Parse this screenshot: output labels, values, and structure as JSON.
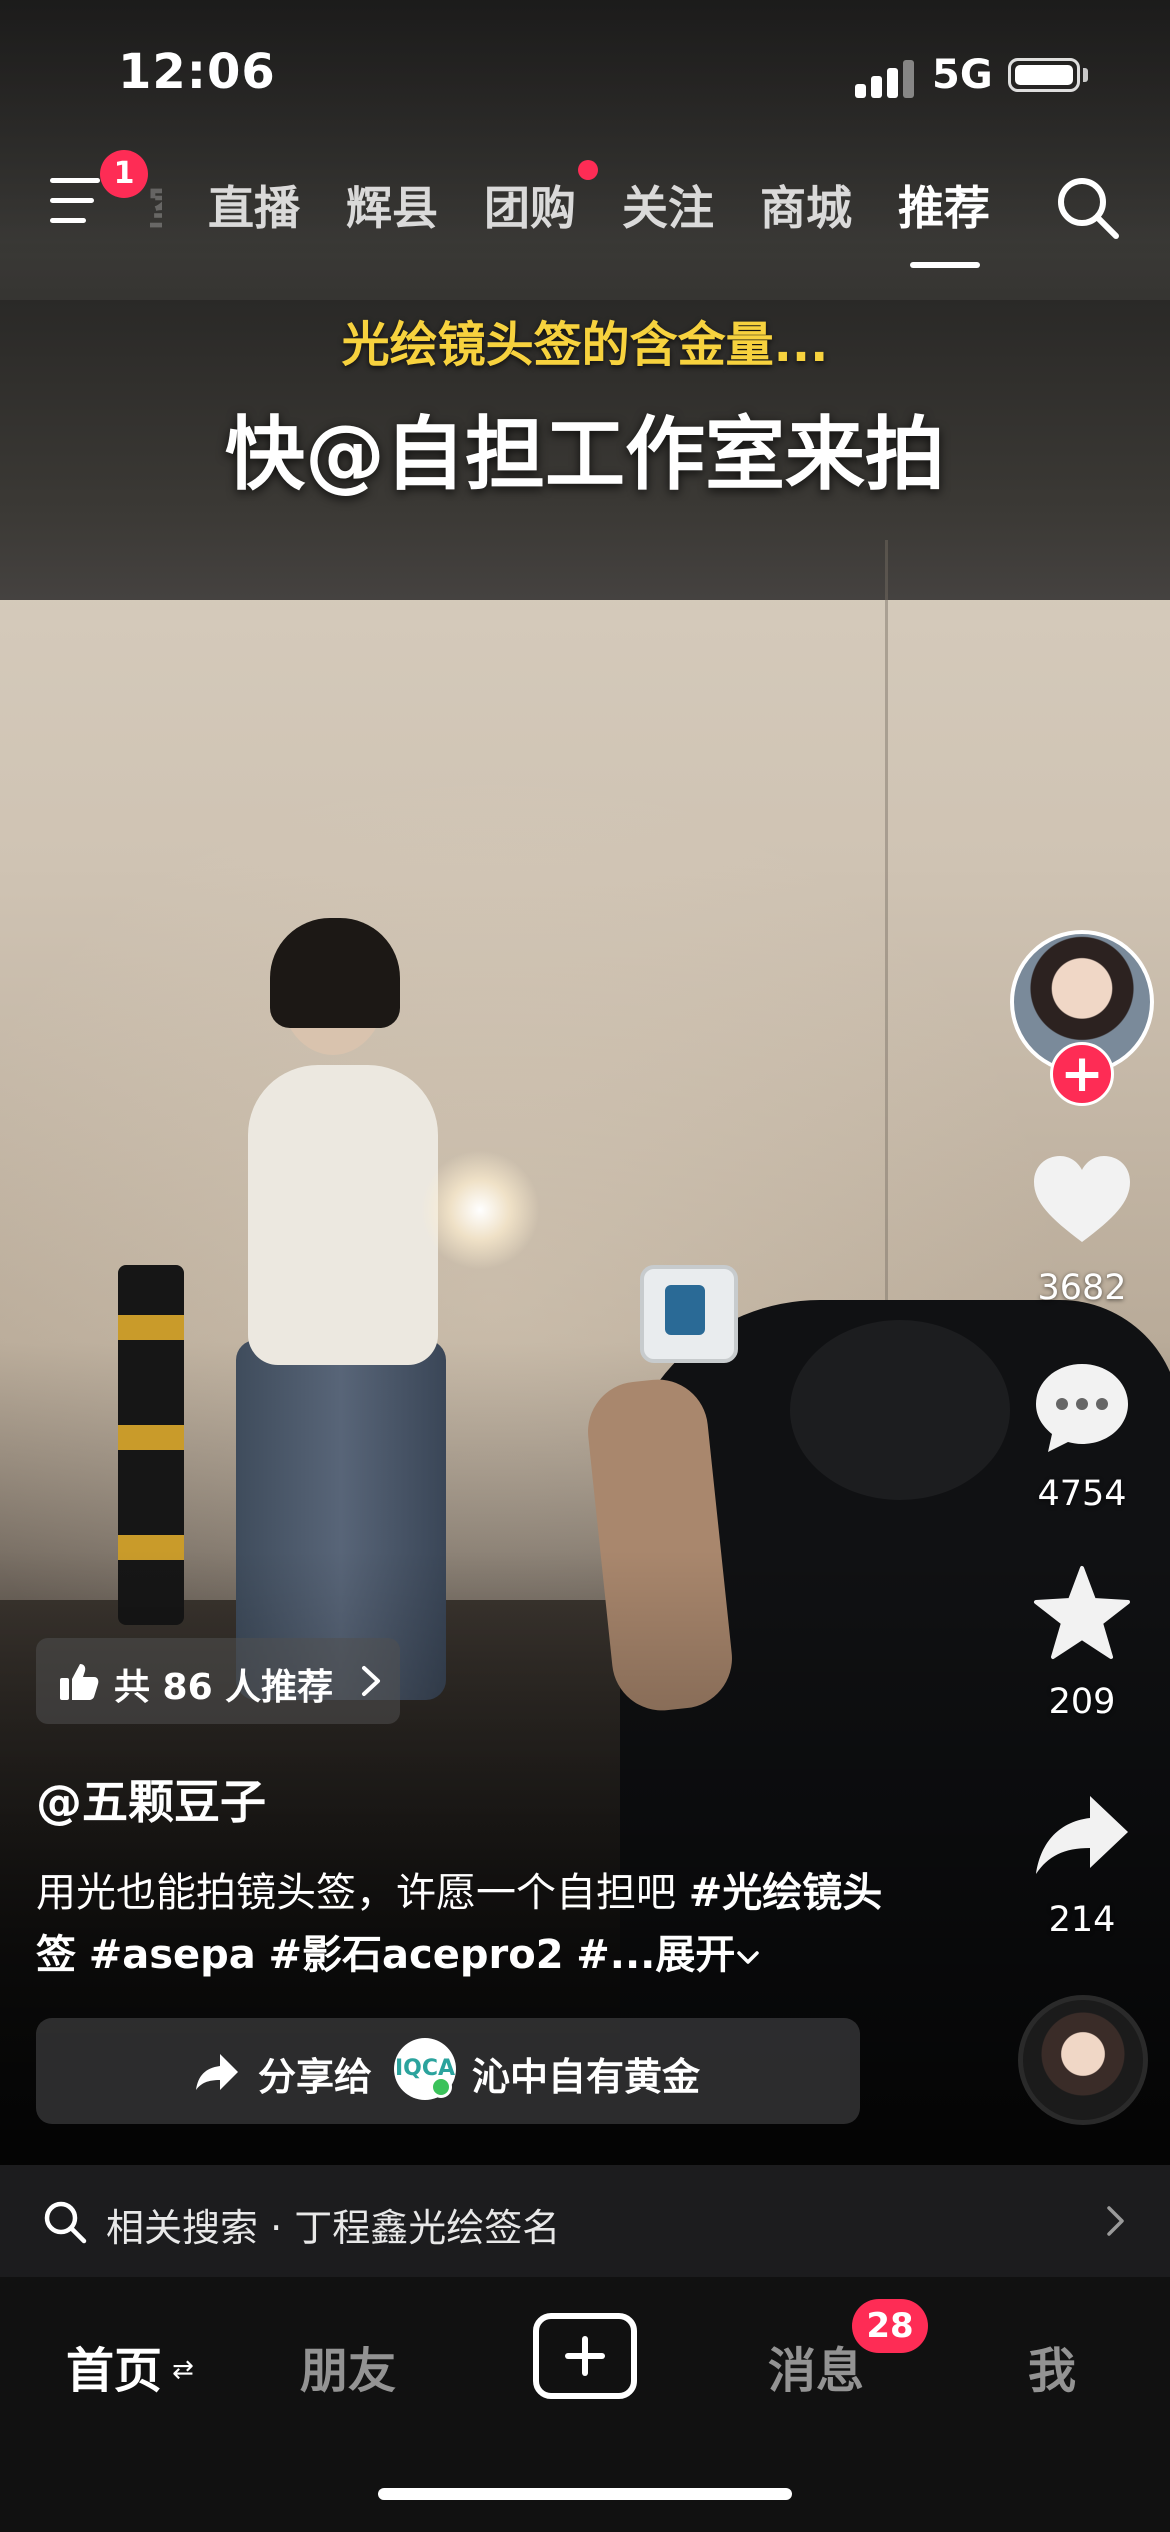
{
  "status_bar": {
    "time": "12:06",
    "network": "5G"
  },
  "top_nav": {
    "menu_badge": "1",
    "partial_tab": "室",
    "tabs": [
      "直播",
      "辉县",
      "团购",
      "关注",
      "商城",
      "推荐"
    ],
    "active_tab": "推荐",
    "dot_on_tab": "团购"
  },
  "video_caption": {
    "subtitle": "光绘镜头签的含金量...",
    "title": "快@自担工作室来拍"
  },
  "actions": {
    "likes": "3682",
    "comments": "4754",
    "favorites": "209",
    "shares": "214"
  },
  "recommend_pill": {
    "label": "共 86 人推荐"
  },
  "post": {
    "author": "@五颗豆子",
    "desc_text": "用光也能拍镜头签，许愿一个自担吧 ",
    "tag1": "#光绘镜头签",
    "tag2": "#asepa",
    "tag3": "#影石acepro2",
    "tag4": "#...",
    "more": "展开"
  },
  "share_bar": {
    "label": "分享给",
    "fav_logo_text": "IQCA",
    "name": "沁中自有黄金"
  },
  "related_search": {
    "text": "相关搜索 · 丁程鑫光绘签名"
  },
  "tab_bar": {
    "home": "首页",
    "friends": "朋友",
    "messages": "消息",
    "messages_badge": "28",
    "me": "我"
  },
  "colors": {
    "accent": "#fe2c55",
    "caption_yellow": "#f7d23e"
  }
}
